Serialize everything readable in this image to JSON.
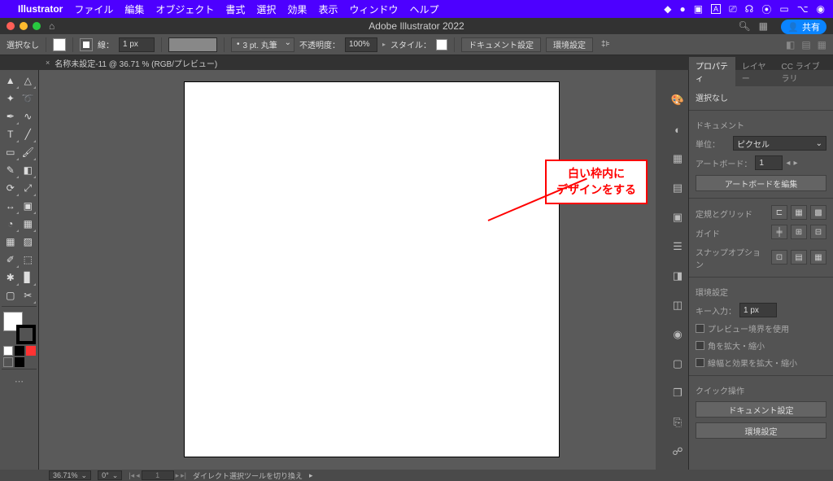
{
  "menubar": {
    "app_name": "Illustrator",
    "items": [
      "ファイル",
      "編集",
      "オブジェクト",
      "書式",
      "選択",
      "効果",
      "表示",
      "ウィンドウ",
      "ヘルプ"
    ]
  },
  "window": {
    "title": "Adobe Illustrator 2022",
    "share": "共有"
  },
  "control": {
    "no_selection": "選択なし",
    "stroke_label": "線：",
    "stroke_width": "1 px",
    "brush_value": "3 pt. 丸筆",
    "opacity_label": "不透明度：",
    "opacity_value": "100%",
    "style_label": "スタイル：",
    "doc_setup": "ドキュメント設定",
    "prefs": "環境設定"
  },
  "tab": {
    "name": "名称未設定-11 @ 36.71 % (RGB/プレビュー)"
  },
  "annotation": {
    "line1": "白い枠内に",
    "line2": "デザインをする"
  },
  "props": {
    "tab_properties": "プロパティ",
    "tab_layers": "レイヤー",
    "tab_cc": "CC ライブラリ",
    "no_selection": "選択なし",
    "document": "ドキュメント",
    "units_label": "単位：",
    "units_value": "ピクセル",
    "artboard_label": "アートボード：",
    "artboard_value": "1",
    "edit_artboard": "アートボードを編集",
    "ruler_grid": "定規とグリッド",
    "guides": "ガイド",
    "snap_options": "スナップオプション",
    "prefs": "環境設定",
    "key_input_label": "キー入力：",
    "key_input_value": "1 px",
    "chk_preview": "プレビュー境界を使用",
    "chk_corners": "角を拡大・縮小",
    "chk_effects": "線幅と効果を拡大・縮小",
    "quick_ops": "クイック操作",
    "doc_setup_btn": "ドキュメント設定",
    "prefs_btn": "環境設定"
  },
  "status": {
    "zoom": "36.71%",
    "rotation": "0°",
    "page": "1",
    "hint": "ダイレクト選択ツールを切り換え"
  }
}
